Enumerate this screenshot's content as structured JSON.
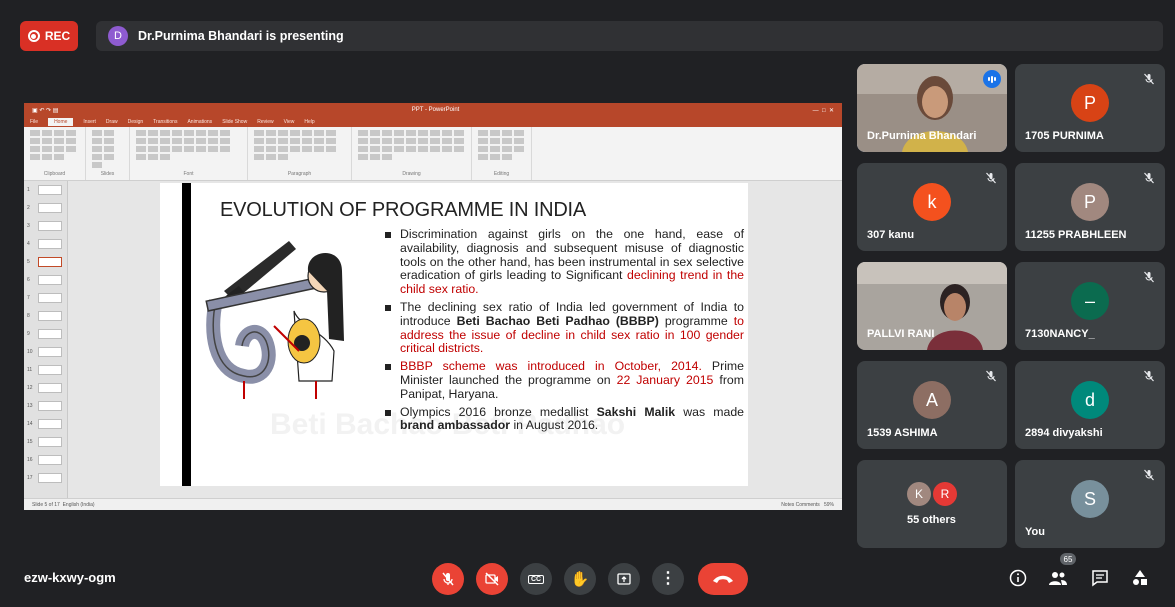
{
  "header": {
    "rec_label": "REC",
    "presenter_initial": "D",
    "presenting_text": "Dr.Purnima Bhandari is presenting"
  },
  "ppt": {
    "window_title": "PPT - PowerPoint",
    "tabs": [
      "File",
      "Home",
      "Insert",
      "Draw",
      "Design",
      "Transitions",
      "Animations",
      "Slide Show",
      "Review",
      "View",
      "Help"
    ],
    "active_tab": "Home",
    "ribbon_groups": [
      "Clipboard",
      "Slides",
      "Font",
      "Paragraph",
      "Drawing",
      "Editing"
    ],
    "thumb_numbers": [
      "1",
      "2",
      "3",
      "4",
      "5",
      "6",
      "7",
      "8",
      "9",
      "10",
      "11",
      "12",
      "13",
      "14",
      "15",
      "16",
      "17"
    ],
    "status_left": "Slide 5 of 17",
    "status_lang": "English (India)",
    "status_right": "Notes   Comments",
    "zoom": "59%"
  },
  "slide": {
    "title": "EVOLUTION OF PROGRAMME IN INDIA",
    "watermark": "Beti Bachao Beti Padhao",
    "b1_text": "Discrimination against girls on the one hand, ease of availability, diagnosis and subsequent misuse of diagnostic tools on the other hand, has been instrumental in sex selective eradication of girls leading to Significant ",
    "b1_red": "declining trend in the child sex ratio.",
    "b2_text": "The declining sex ratio of India led government of India to introduce ",
    "b2_bold": "Beti Bachao Beti Padhao (BBBP)",
    "b2_text2": " programme ",
    "b2_red": "to address the issue of decline in child sex ratio in 100 gender critical districts.",
    "b3_red": "BBBP scheme was introduced in October, 2014.",
    "b3_text": " Prime Minister launched the programme on ",
    "b3_red2": "22 January 2015",
    "b3_text2": " from Panipat, Haryana.",
    "b4_text": "Olympics 2016 bronze medallist ",
    "b4_bold": "Sakshi Malik",
    "b4_text2": " was made ",
    "b4_bold2": "brand ambassador",
    "b4_text3": " in August 2016."
  },
  "participants": [
    {
      "name": "Dr.Purnima Bhandari",
      "type": "video",
      "speaking": true
    },
    {
      "name": "1705 PURNIMA",
      "initial": "P",
      "color": "#d84315"
    },
    {
      "name": "307 kanu",
      "initial": "k",
      "color": "#f4511e"
    },
    {
      "name": "11255 PRABHLEEN",
      "initial": "P",
      "color": "#a1887f"
    },
    {
      "name": "PALLVI RANI",
      "type": "video"
    },
    {
      "name": "7130NANCY_",
      "initial": "–",
      "color": "#0b6b4f"
    },
    {
      "name": "1539 ASHIMA",
      "initial": "A",
      "color": "#8d6e63"
    },
    {
      "name": "2894 divyakshi",
      "initial": "d",
      "color": "#00897b"
    },
    {
      "name": "55 others",
      "initials": [
        "K",
        "R"
      ],
      "colors": [
        "#a1887f",
        "#e53935"
      ]
    },
    {
      "name": "You",
      "initial": "S",
      "color": "#78909c"
    }
  ],
  "footer": {
    "meeting_code": "ezw-kxwy-ogm",
    "people_count": "65",
    "cc_label": "CC"
  },
  "colors": {
    "accent_red": "#ea4335",
    "active_blue": "#8ab4f8",
    "ppt_brand": "#b7472a"
  }
}
